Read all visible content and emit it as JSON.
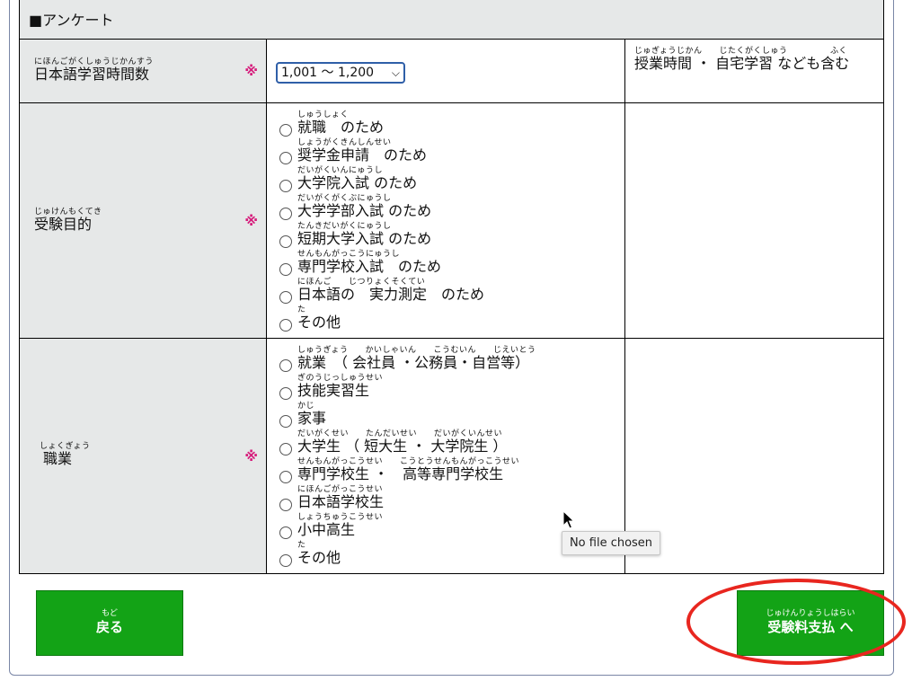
{
  "section": {
    "title": "■アンケート"
  },
  "study_hours": {
    "label_ruby": "にほんごがくしゅうじかんすう",
    "label": "日本語学習時間数",
    "required_mark": "※",
    "select_value": "1,001 〜 1,200",
    "note_ruby": "じゅぎょうじかん　　じたくがくしゅう　　　　　ふく",
    "note_text": "授業時間 ・ 自宅学習 なども含む"
  },
  "purpose": {
    "label_ruby": "じゅけんもくてき",
    "label": "受験目的",
    "required_mark": "※",
    "options": [
      {
        "ruby": "しゅうしょく",
        "text": "就職　のため"
      },
      {
        "ruby": "しょうがくきんしんせい",
        "text": "奨学金申請　のため"
      },
      {
        "ruby": "だいがくいんにゅうし",
        "text": "大学院入試 のため"
      },
      {
        "ruby": "だいがくがくぶにゅうし",
        "text": "大学学部入試 のため"
      },
      {
        "ruby": "たんきだいがくにゅうし",
        "text": "短期大学入試 のため"
      },
      {
        "ruby": "せんもんがっこうにゅうし",
        "text": "専門学校入試　のため"
      },
      {
        "ruby": "にほんご　　じつりょくそくてい",
        "text": "日本語の　実力測定　のため"
      },
      {
        "ruby": "た",
        "text": "その他"
      }
    ]
  },
  "occupation": {
    "label_ruby": "しょくぎょう",
    "label": "職業",
    "required_mark": "※",
    "options": [
      {
        "ruby": "しゅうぎょう　　かいしゃいん　　こうむいん　　じえいとう",
        "text": "就業　（ 会社員 ・公務員・自営等）"
      },
      {
        "ruby": "ぎのうじっしゅうせい",
        "text": "技能実習生"
      },
      {
        "ruby": "かじ",
        "text": "家事"
      },
      {
        "ruby": "だいがくせい　　たんだいせい　　だいがくいんせい",
        "text": "大学生 （ 短大生 ・ 大学院生 ）"
      },
      {
        "ruby": "せんもんがっこうせい　　こうとうせんもんがっこうせい",
        "text": "専門学校生 ・　高等専門学校生"
      },
      {
        "ruby": "にほんごがっこうせい",
        "text": "日本語学校生"
      },
      {
        "ruby": "しょうちゅうこうせい",
        "text": "小中高生"
      },
      {
        "ruby": "た",
        "text": "その他"
      }
    ]
  },
  "tooltip": {
    "text": "No file chosen"
  },
  "buttons": {
    "back_ruby": "もど",
    "back_label": "戻る",
    "pay_ruby": "じゅけんりょうしはらい",
    "pay_label": "受験料支払 へ"
  },
  "colors": {
    "button_green": "#13a316",
    "required_mark": "#d61c7b",
    "highlight_red": "#e8261f",
    "label_bg": "#e6e8e8"
  }
}
